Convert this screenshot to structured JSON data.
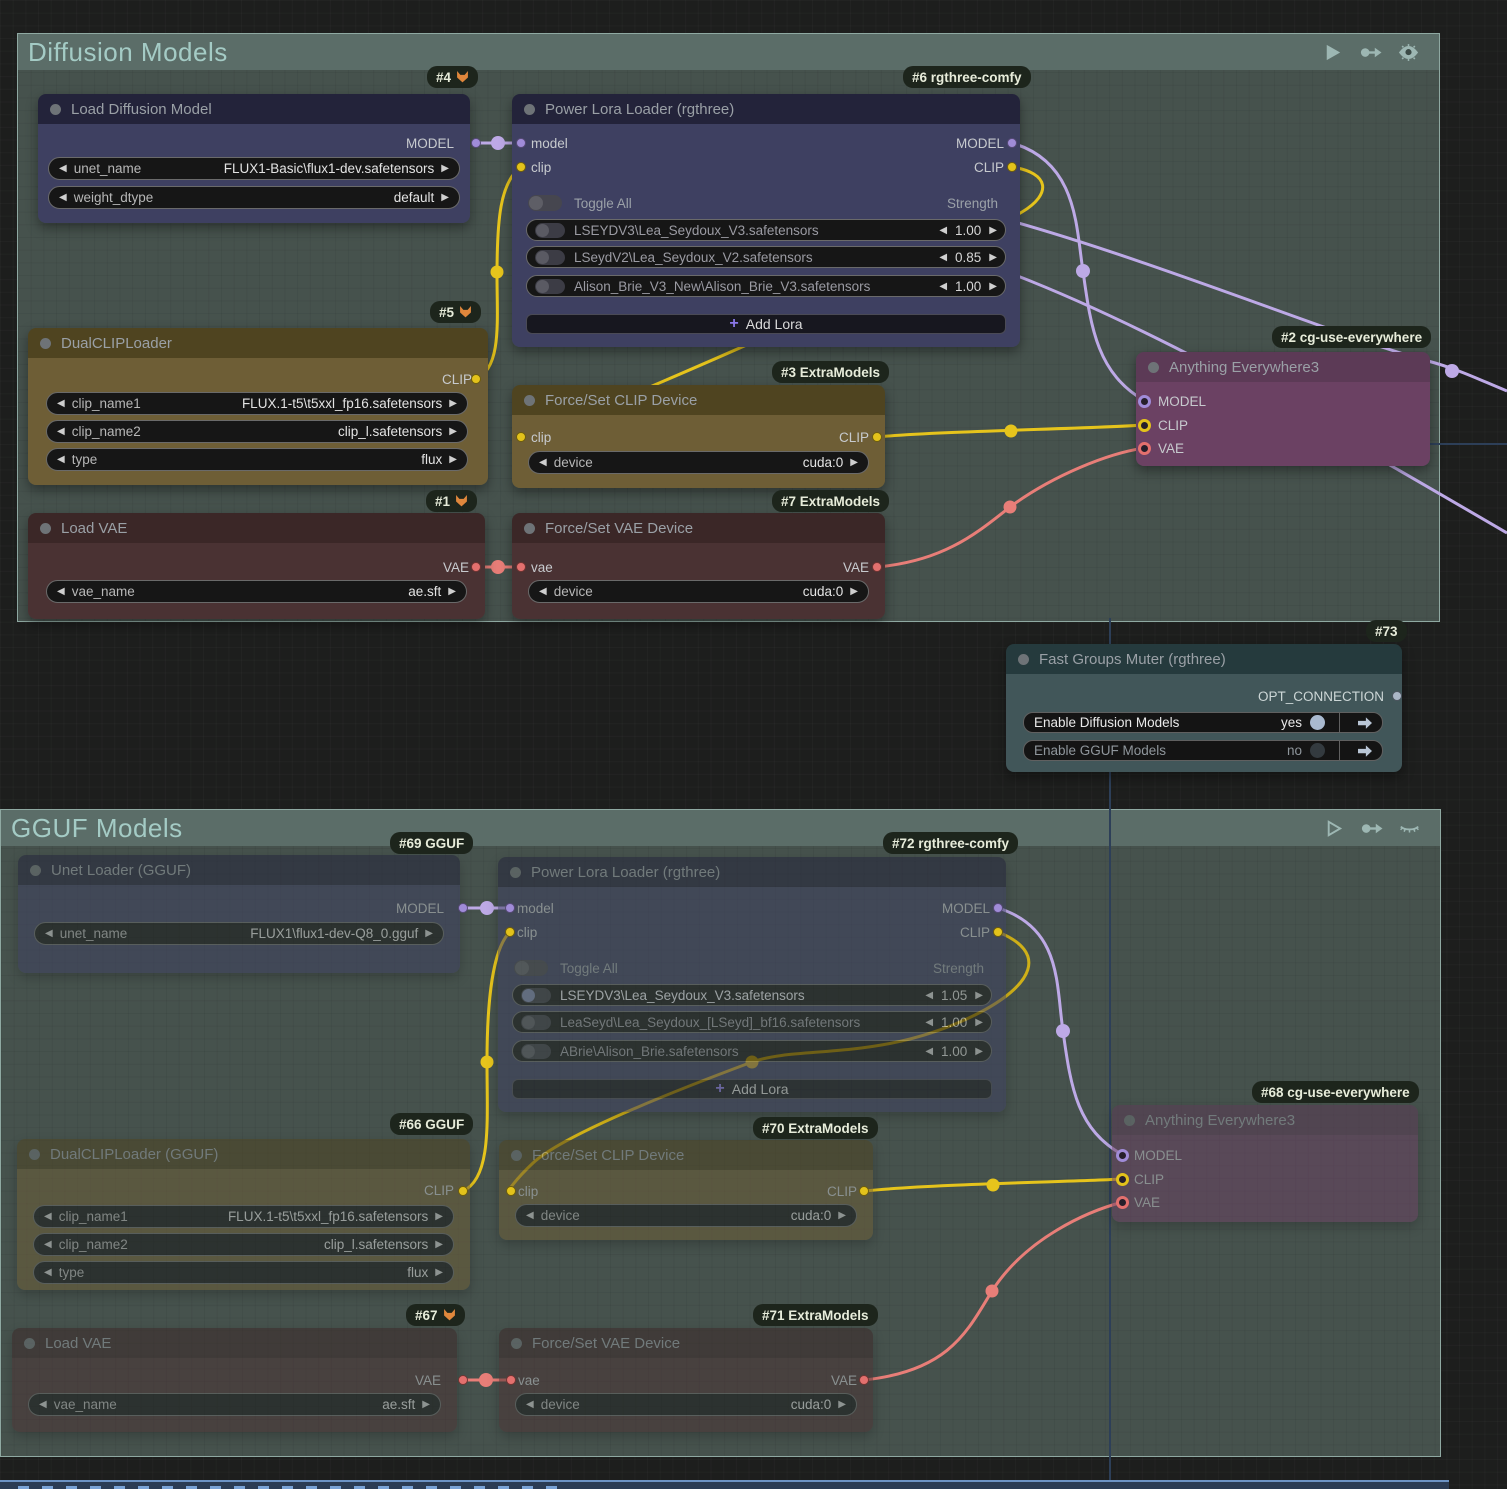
{
  "groups": {
    "diffusion": {
      "title": "Diffusion Models"
    },
    "gguf": {
      "title": "GGUF Models"
    }
  },
  "palette": {
    "wire_model": "#bda9e6",
    "wire_clip": "#e6c41c",
    "wire_vae": "#e87e78",
    "group_bg": "#46524d",
    "group_header": "#5b6d68",
    "accent_plus": "#8a77e8"
  },
  "badges": {
    "load_diffusion": "#4",
    "power_lora_1": "#6 rgthree-comfy",
    "dual_clip_1": "#5",
    "force_clip_1": "#3 ExtraModels",
    "load_vae_1": "#1",
    "force_vae_1": "#7 ExtraModels",
    "anything_1": "#2 cg-use-everywhere",
    "muter": "#73",
    "unet_gguf": "#69 GGUF",
    "power_lora_2": "#72 rgthree-comfy",
    "dual_clip_2": "#66 GGUF",
    "force_clip_2": "#70 ExtraModels",
    "load_vae_2": "#67",
    "force_vae_2": "#71 ExtraModels",
    "anything_2": "#68 cg-use-everywhere"
  },
  "nodes": {
    "load_diffusion": {
      "title": "Load Diffusion Model",
      "out": "MODEL",
      "widgets": [
        {
          "label": "unet_name",
          "value": "FLUX1-Basic\\flux1-dev.safetensors"
        },
        {
          "label": "weight_dtype",
          "value": "default"
        }
      ]
    },
    "power_lora_1": {
      "title": "Power Lora Loader (rgthree)",
      "in_model": "model",
      "in_clip": "clip",
      "out_model": "MODEL",
      "out_clip": "CLIP",
      "toggle_all": "Toggle All",
      "strength": "Strength",
      "add_lora": "Add Lora",
      "loras": [
        {
          "name": "LSEYDV3\\Lea_Seydoux_V3.safetensors",
          "strength": "1.00"
        },
        {
          "name": "LSeydV2\\Lea_Seydoux_V2.safetensors",
          "strength": "0.85"
        },
        {
          "name": "Alison_Brie_V3_New\\Alison_Brie_V3.safetensors",
          "strength": "1.00"
        }
      ]
    },
    "dual_clip_1": {
      "title": "DualCLIPLoader",
      "out": "CLIP",
      "widgets": [
        {
          "label": "clip_name1",
          "value": "FLUX.1-t5\\t5xxl_fp16.safetensors"
        },
        {
          "label": "clip_name2",
          "value": "clip_l.safetensors"
        },
        {
          "label": "type",
          "value": "flux"
        }
      ]
    },
    "force_clip_1": {
      "title": "Force/Set CLIP Device",
      "in": "clip",
      "out": "CLIP",
      "widgets": [
        {
          "label": "device",
          "value": "cuda:0"
        }
      ]
    },
    "load_vae_1": {
      "title": "Load VAE",
      "out": "VAE",
      "widgets": [
        {
          "label": "vae_name",
          "value": "ae.sft"
        }
      ]
    },
    "force_vae_1": {
      "title": "Force/Set VAE Device",
      "in": "vae",
      "out": "VAE",
      "widgets": [
        {
          "label": "device",
          "value": "cuda:0"
        }
      ]
    },
    "anything_1": {
      "title": "Anything Everywhere3",
      "inputs": [
        "MODEL",
        "CLIP",
        "VAE"
      ]
    },
    "muter": {
      "title": "Fast Groups Muter (rgthree)",
      "out": "OPT_CONNECTION",
      "rows": [
        {
          "label": "Enable Diffusion Models",
          "value": "yes"
        },
        {
          "label": "Enable GGUF Models",
          "value": "no"
        }
      ]
    },
    "unet_gguf": {
      "title": "Unet Loader (GGUF)",
      "out": "MODEL",
      "widgets": [
        {
          "label": "unet_name",
          "value": "FLUX1\\flux1-dev-Q8_0.gguf"
        }
      ]
    },
    "power_lora_2": {
      "title": "Power Lora Loader (rgthree)",
      "in_model": "model",
      "in_clip": "clip",
      "out_model": "MODEL",
      "out_clip": "CLIP",
      "toggle_all": "Toggle All",
      "strength": "Strength",
      "add_lora": "Add Lora",
      "loras": [
        {
          "name": "LSEYDV3\\Lea_Seydoux_V3.safetensors",
          "strength": "1.05"
        },
        {
          "name": "LeaSeyd\\Lea_Seydoux_[LSeyd]_bf16.safetensors",
          "strength": "1.00"
        },
        {
          "name": "ABrie\\Alison_Brie.safetensors",
          "strength": "1.00"
        }
      ]
    },
    "dual_clip_2": {
      "title": "DualCLIPLoader (GGUF)",
      "out": "CLIP",
      "widgets": [
        {
          "label": "clip_name1",
          "value": "FLUX.1-t5\\t5xxl_fp16.safetensors"
        },
        {
          "label": "clip_name2",
          "value": "clip_l.safetensors"
        },
        {
          "label": "type",
          "value": "flux"
        }
      ]
    },
    "force_clip_2": {
      "title": "Force/Set CLIP Device",
      "in": "clip",
      "out": "CLIP",
      "widgets": [
        {
          "label": "device",
          "value": "cuda:0"
        }
      ]
    },
    "load_vae_2": {
      "title": "Load VAE",
      "out": "VAE",
      "widgets": [
        {
          "label": "vae_name",
          "value": "ae.sft"
        }
      ]
    },
    "force_vae_2": {
      "title": "Force/Set VAE Device",
      "in": "vae",
      "out": "VAE",
      "widgets": [
        {
          "label": "device",
          "value": "cuda:0"
        }
      ]
    },
    "anything_2": {
      "title": "Anything Everywhere3",
      "inputs": [
        "MODEL",
        "CLIP",
        "VAE"
      ]
    }
  }
}
